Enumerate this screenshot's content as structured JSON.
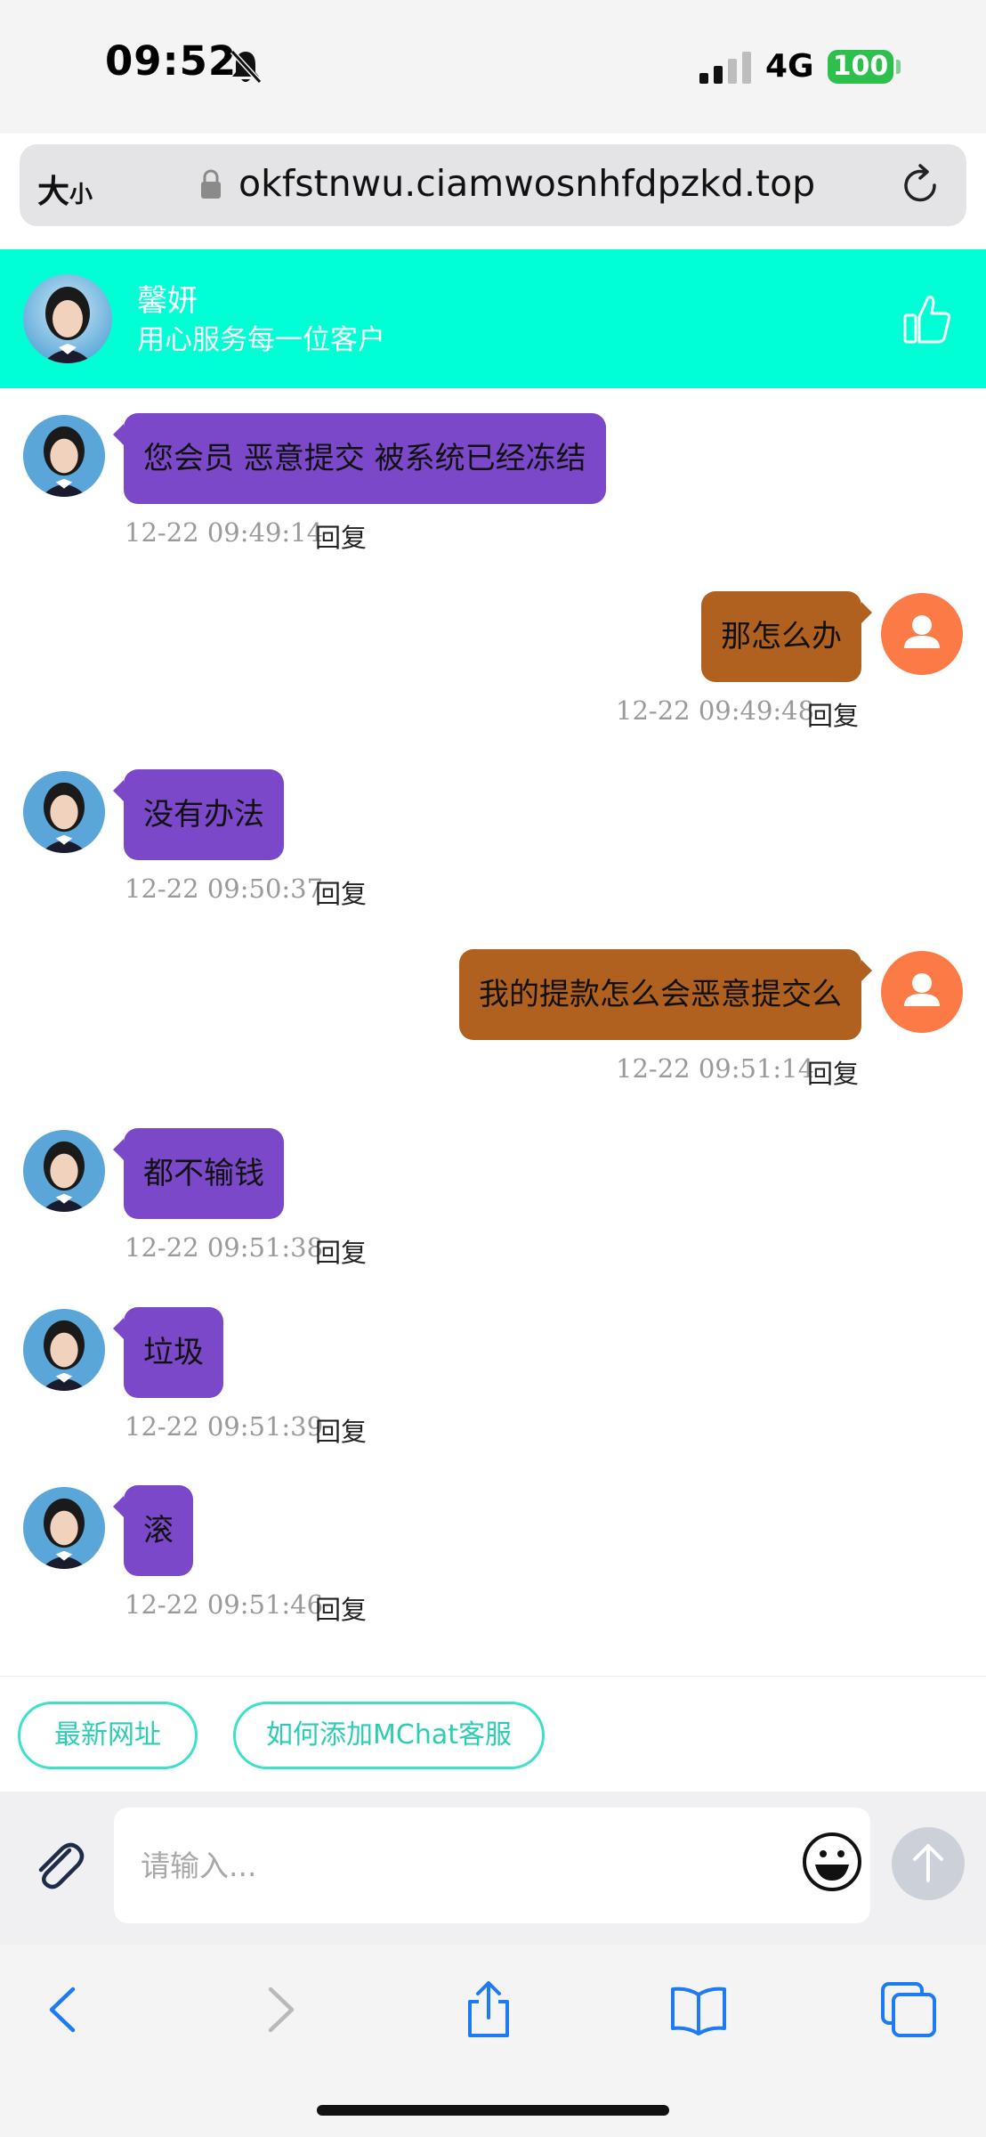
{
  "status_bar": {
    "time": "09:52",
    "network": "4G",
    "battery": "100",
    "colors": {
      "battery": "#2ec04d"
    }
  },
  "browser": {
    "text_size_label_big": "大",
    "text_size_label_small": "小",
    "url": "okfstnwu.ciamwosnhfdpzkd.top",
    "icons": [
      "lock-icon",
      "reload-icon"
    ]
  },
  "header": {
    "agent_name": "馨妍",
    "slogan": "用心服务每一位客户",
    "colors": {
      "background": "#00ffd4"
    },
    "icons": [
      "like-icon"
    ]
  },
  "messages": [
    {
      "sender": "agent",
      "text": "您会员  恶意提交 被系统已经冻结",
      "time": "12-22 09:49:14",
      "reply": "回复"
    },
    {
      "sender": "user",
      "text": "那怎么办",
      "time": "12-22 09:49:48",
      "reply": "回复"
    },
    {
      "sender": "agent",
      "text": "没有办法",
      "time": "12-22 09:50:37",
      "reply": "回复"
    },
    {
      "sender": "user",
      "text": "我的提款怎么会恶意提交么",
      "time": "12-22 09:51:14",
      "reply": "回复"
    },
    {
      "sender": "agent",
      "text": "都不输钱",
      "time": "12-22 09:51:38",
      "reply": "回复"
    },
    {
      "sender": "agent",
      "text": "垃圾",
      "time": "12-22 09:51:39",
      "reply": "回复"
    },
    {
      "sender": "agent",
      "text": "滚",
      "time": "12-22 09:51:46",
      "reply": "回复"
    }
  ],
  "bubble_colors": {
    "agent": "#7a48c9",
    "user": "#b0601f",
    "user_avatar": "#fb7a45"
  },
  "quick_links": [
    "最新网址",
    "如何添加MChat客服"
  ],
  "composer": {
    "placeholder": "请输入...",
    "icons": [
      "paperclip-icon",
      "emoji-icon",
      "send-arrow-icon"
    ]
  },
  "toolbar": {
    "icons": [
      "back-icon",
      "forward-icon",
      "share-icon",
      "bookmarks-icon",
      "tabs-icon"
    ]
  }
}
